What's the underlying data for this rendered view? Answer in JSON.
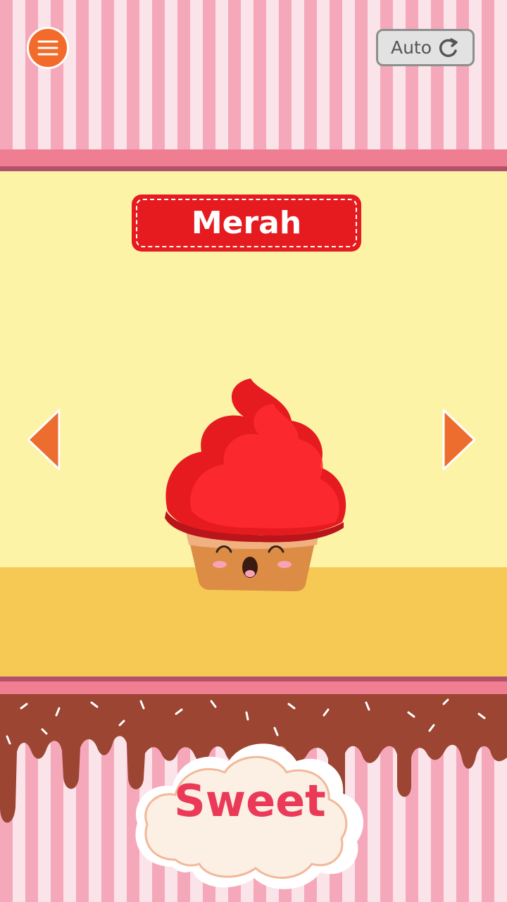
{
  "header": {
    "menu_icon": "hamburger-menu-icon",
    "auto_label": "Auto",
    "auto_icon": "refresh-icon"
  },
  "card": {
    "color_name": "Merah",
    "item": "cupcake",
    "item_color": "#e51b20"
  },
  "navigation": {
    "prev_icon": "triangle-left-icon",
    "next_icon": "triangle-right-icon"
  },
  "footer": {
    "brand": "Sweet"
  },
  "colors": {
    "accent_orange": "#f26b2a",
    "title_red": "#e51b20",
    "stage_yellow": "#fdf3a6",
    "floor_yellow": "#f6c954",
    "stripe_pink": "#f6a8bb",
    "chocolate": "#9b4532",
    "brand_pink": "#ea3a58"
  }
}
